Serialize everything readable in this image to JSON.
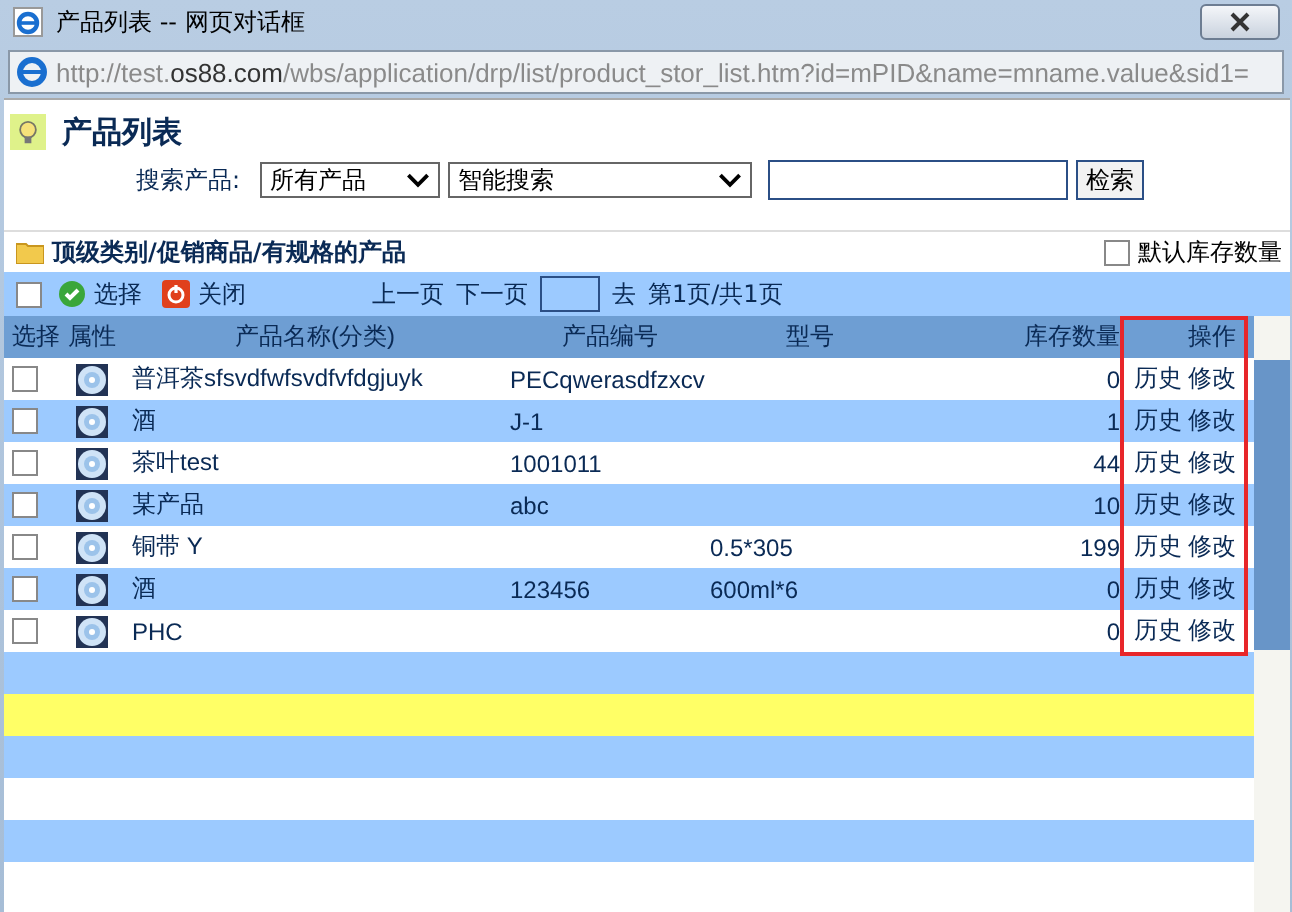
{
  "window": {
    "title": "产品列表 -- 网页对话框",
    "url_host_prefix": "http://test.",
    "url_host": "os88.com",
    "url_path": "/wbs/application/drp/list/product_stor_list.htm?id=mPID&name=mname.value&sid1="
  },
  "page": {
    "title": "产品列表"
  },
  "search": {
    "label": "搜索产品:",
    "scope": "所有产品",
    "mode": "智能搜索",
    "button": "检索"
  },
  "category": {
    "path": "顶级类别/促销商品/有规格的产品",
    "default_stock": {
      "label": "默认库存数量",
      "checked": false
    }
  },
  "toolbar": {
    "select_all": false,
    "select": "选择",
    "close": "关闭",
    "prev": "上一页",
    "next": "下一页",
    "go": "去",
    "page_info": "第1页/共1页"
  },
  "table": {
    "columns": [
      "选择",
      "属性",
      "产品名称(分类)",
      "产品编号",
      "型号",
      "库存数量",
      "操作"
    ],
    "rows": [
      {
        "checked": false,
        "name": "普洱茶sfsvdfwfsvdfvfdgjuyk",
        "code": "PECqwerasdfzxcv",
        "model": "",
        "stock": "0",
        "actions": [
          "历史",
          "修改"
        ]
      },
      {
        "checked": false,
        "name": "酒",
        "code": "J-1",
        "model": "",
        "stock": "1",
        "actions": [
          "历史",
          "修改"
        ]
      },
      {
        "checked": false,
        "name": "茶叶test",
        "code": "1001011",
        "model": "",
        "stock": "44",
        "actions": [
          "历史",
          "修改"
        ]
      },
      {
        "checked": false,
        "name": "某产品",
        "code": "abc",
        "model": "",
        "stock": "10",
        "actions": [
          "历史",
          "修改"
        ]
      },
      {
        "checked": false,
        "name": "铜带 Y",
        "code": "",
        "model": "0.5*305",
        "stock": "199",
        "actions": [
          "历史",
          "修改"
        ]
      },
      {
        "checked": false,
        "name": "酒",
        "code": "123456",
        "model": "600ml*6",
        "stock": "0",
        "actions": [
          "历史",
          "修改"
        ]
      },
      {
        "checked": false,
        "name": "PHC",
        "code": "",
        "model": "",
        "stock": "0",
        "actions": [
          "历史",
          "修改"
        ]
      }
    ],
    "empty_rows": [
      {
        "selected": false
      },
      {
        "selected": true
      },
      {
        "selected": false
      },
      {
        "selected": false
      },
      {
        "selected": false
      },
      {
        "selected": false
      }
    ]
  }
}
